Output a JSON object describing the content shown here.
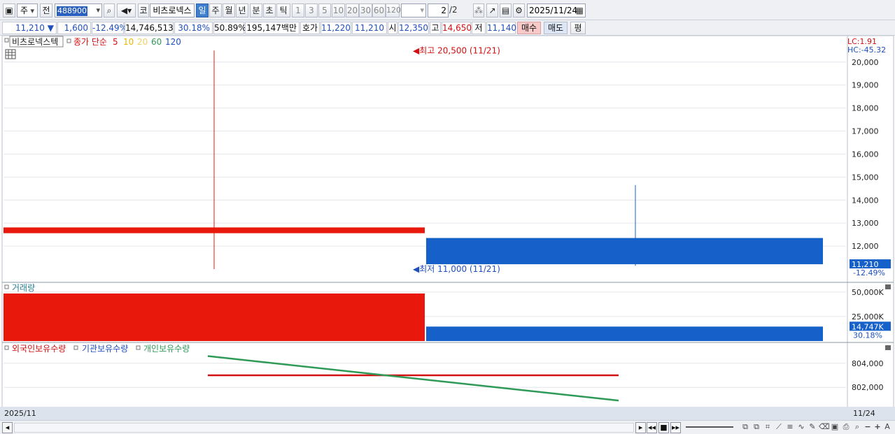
{
  "toolbar": {
    "period_label": "주",
    "prev_label": "전",
    "stock_code": "488900",
    "market_label": "코",
    "stock_name": "비츠로넥스",
    "periods": [
      "일",
      "주",
      "월",
      "년",
      "분",
      "초",
      "틱"
    ],
    "selected_period": "일",
    "intervals": [
      "1",
      "3",
      "5",
      "10",
      "20",
      "30",
      "60",
      "120"
    ],
    "page": "2",
    "page_total": "/2",
    "date": "2025/11/24"
  },
  "quote": {
    "price": "11,210",
    "change_arrow": "▼",
    "change": "1,600",
    "change_pct": "-12.49%",
    "volume": "14,746,513",
    "turnover_pct": "30.18%",
    "ratio": "50.89%",
    "amount": "195,147백만",
    "bid_ask_label": "호가",
    "ask": "11,220",
    "bid": "11,210",
    "open_label": "시",
    "open": "12,350",
    "high_label": "고",
    "high": "14,650",
    "low_label": "저",
    "low": "11,140",
    "buy_label": "매수",
    "sell_label": "매도",
    "eval_label": "평"
  },
  "colors": {
    "up": "#e8190c",
    "down": "#1560c9",
    "foreign": "#d21010",
    "individual": "#2f9a57"
  },
  "chart_data": [
    {
      "type": "candlestick",
      "title": "비츠로넥스텍",
      "legend": {
        "label": "종가 단순",
        "ma": [
          {
            "name": "5",
            "color": "#d21010"
          },
          {
            "name": "10",
            "color": "#e6b800"
          },
          {
            "name": "20",
            "color": "#f0d060"
          },
          {
            "name": "60",
            "color": "#2f9a57"
          },
          {
            "name": "120",
            "color": "#1f4fbf"
          }
        ]
      },
      "lc_label": "LC:1.91",
      "hc_label": "HC:-45.32",
      "ylim": [
        11000,
        20600
      ],
      "yticks": [
        12000,
        13000,
        14000,
        15000,
        16000,
        17000,
        18000,
        19000,
        20000
      ],
      "ytick_labels": [
        "12,000",
        "13,000",
        "14,000",
        "15,000",
        "16,000",
        "17,000",
        "18,000",
        "19,000",
        "20,000"
      ],
      "candles": [
        {
          "date": "2025/11/21",
          "open": 12560,
          "close": 12810,
          "high": 20500,
          "low": 11000,
          "direction": "up"
        },
        {
          "date": "2025/11/24",
          "open": 12350,
          "close": 11210,
          "high": 14650,
          "low": 11140,
          "direction": "down"
        }
      ],
      "max_annotation": "최고 20,500 (11/21)",
      "min_annotation": "최저 11,000 (11/21)",
      "last_price_label": "11,210",
      "last_change_label": "-12.49%"
    },
    {
      "type": "bar",
      "title": "거래량",
      "ylim": [
        0,
        57000
      ],
      "yticks": [
        25000,
        50000
      ],
      "ytick_labels": [
        "25,000K",
        "50,000K"
      ],
      "values": [
        48500,
        14747
      ],
      "bar_colors": [
        "up",
        "down"
      ],
      "last_volume_label": "14,747K",
      "last_pct_label": "30.18%"
    },
    {
      "type": "line",
      "legend": [
        "외국인보유수량",
        "기관보유수량",
        "개인보유수량"
      ],
      "ylim": [
        800500,
        805500
      ],
      "yticks": [
        802000,
        804000
      ],
      "ytick_labels": [
        "802,000",
        "804,000"
      ],
      "series": [
        {
          "name": "외국인보유수량",
          "color": "foreign",
          "values": [
            803000,
            803000
          ]
        },
        {
          "name": "개인보유수량",
          "color": "individual",
          "values": [
            804600,
            800900
          ]
        }
      ]
    }
  ],
  "xaxis": {
    "left_label": "2025/11",
    "right_label": "11/24"
  }
}
